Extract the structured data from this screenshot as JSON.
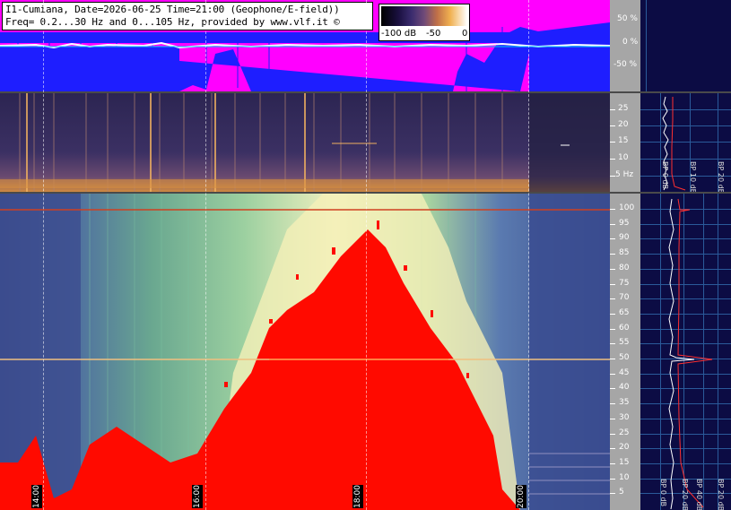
{
  "header": {
    "line1": "I1-Cumiana, Date=2026-06-25 Time=21:00 (Geophone/E-field))",
    "line2": "Freq= 0.2...30 Hz and 0...105 Hz, provided by www.vlf.it ©"
  },
  "colorbar": {
    "min_label": "-100 dB",
    "mid_label": "-50",
    "max_label": "0"
  },
  "top_scale": [
    "50 %",
    "0 %",
    "-50 %"
  ],
  "mid_scale": [
    "25",
    "20",
    "15",
    "10",
    "5 Hz"
  ],
  "main_scale": [
    "100",
    "95",
    "90",
    "85",
    "80",
    "75",
    "70",
    "65",
    "60",
    "55",
    "50",
    "45",
    "40",
    "35",
    "30",
    "25",
    "20",
    "15",
    "10",
    "5"
  ],
  "time_labels": [
    "14:00",
    "16:00",
    "18:00",
    "20:00"
  ],
  "side_panel": {
    "labels": [
      "BP 0 dB",
      "BP 10 dB",
      "BP 20 dB"
    ],
    "labels_main": [
      "BP 0 dB",
      "BP 20 dB",
      "BP 40 dB",
      "BP 20 dB"
    ]
  },
  "colors": {
    "magenta": "#ff00ff",
    "blue": "#1e1eff",
    "navy": "#0c0c44",
    "red": "#ff0a00",
    "scale_gray": "#a6a6a6"
  }
}
